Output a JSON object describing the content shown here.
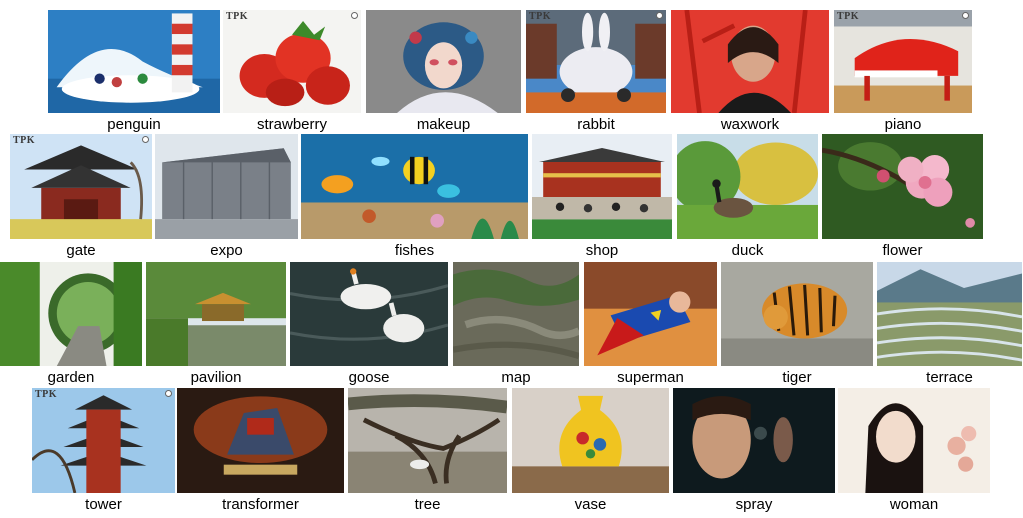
{
  "watermark_text": "TPK",
  "rows": [
    [
      {
        "key": "penguin",
        "label": "penguin",
        "watermark": false
      },
      {
        "key": "strawberry",
        "label": "strawberry",
        "watermark": true
      },
      {
        "key": "makeup",
        "label": "makeup",
        "watermark": false
      },
      {
        "key": "rabbit",
        "label": "rabbit",
        "watermark": true
      },
      {
        "key": "waxwork",
        "label": "waxwork",
        "watermark": false
      },
      {
        "key": "piano",
        "label": "piano",
        "watermark": true
      }
    ],
    [
      {
        "key": "gate",
        "label": "gate",
        "watermark": true
      },
      {
        "key": "expo",
        "label": "expo",
        "watermark": false
      },
      {
        "key": "fishes",
        "label": "fishes",
        "watermark": false
      },
      {
        "key": "shop",
        "label": "shop",
        "watermark": false
      },
      {
        "key": "duck",
        "label": "duck",
        "watermark": false
      },
      {
        "key": "flower",
        "label": "flower",
        "watermark": false
      }
    ],
    [
      {
        "key": "garden",
        "label": "garden",
        "watermark": false
      },
      {
        "key": "pavilion",
        "label": "pavilion",
        "watermark": false
      },
      {
        "key": "goose",
        "label": "goose",
        "watermark": false
      },
      {
        "key": "map",
        "label": "map",
        "watermark": false
      },
      {
        "key": "superman",
        "label": "superman",
        "watermark": false
      },
      {
        "key": "tiger",
        "label": "tiger",
        "watermark": false
      },
      {
        "key": "terrace",
        "label": "terrace",
        "watermark": false
      }
    ],
    [
      {
        "key": "tower",
        "label": "tower",
        "watermark": true
      },
      {
        "key": "transformer",
        "label": "transformer",
        "watermark": false
      },
      {
        "key": "tree",
        "label": "tree",
        "watermark": false
      },
      {
        "key": "vase",
        "label": "vase",
        "watermark": false
      },
      {
        "key": "spray",
        "label": "spray",
        "watermark": false
      },
      {
        "key": "woman",
        "label": "woman",
        "watermark": false
      }
    ]
  ]
}
